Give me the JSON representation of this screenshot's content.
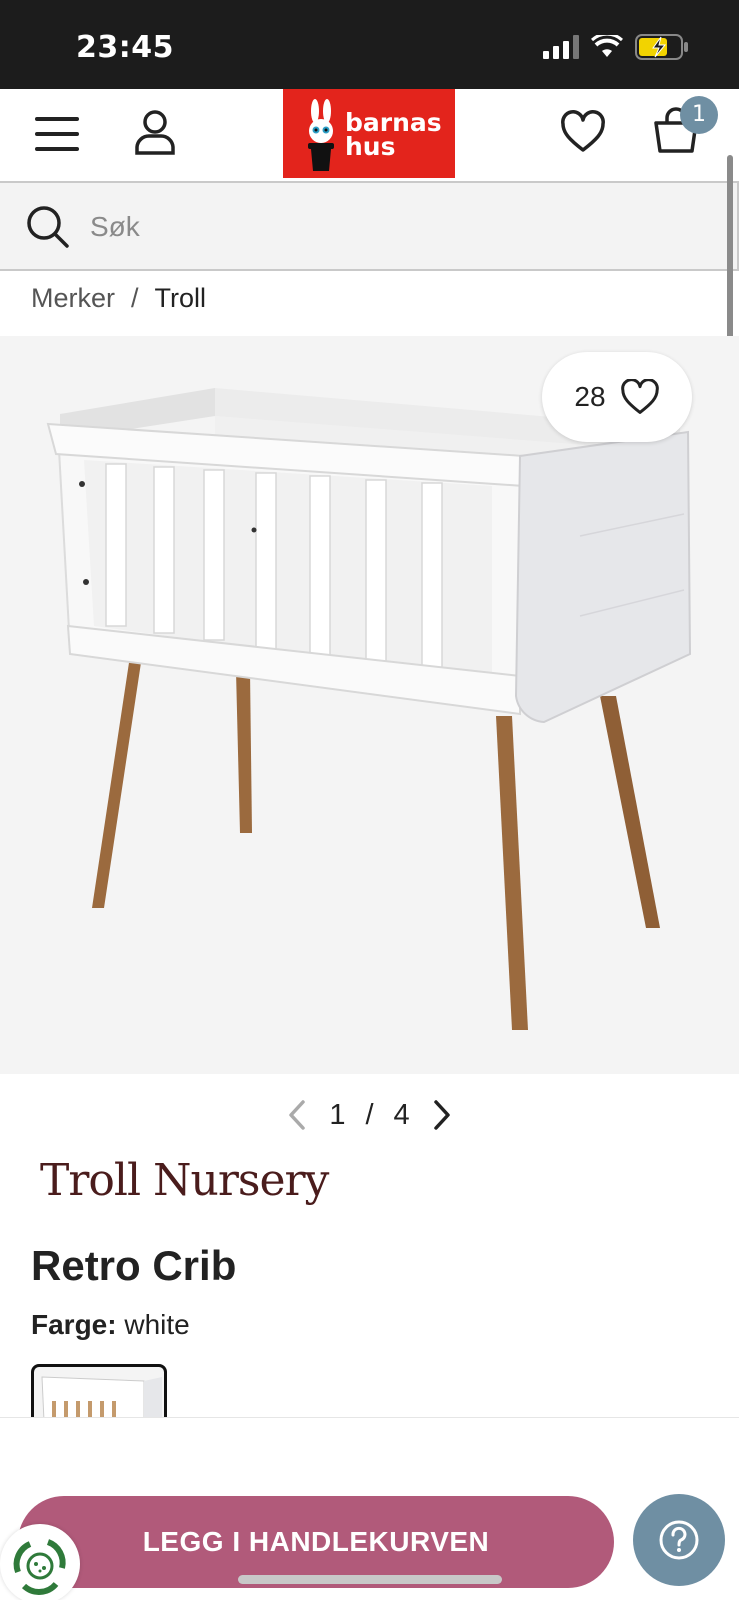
{
  "status_bar": {
    "time": "23:45"
  },
  "header": {
    "logo_line1": "barnas",
    "logo_line2": "hus",
    "cart_count": "1"
  },
  "search": {
    "placeholder": "Søk"
  },
  "breadcrumb": {
    "items": [
      "Merker",
      "Troll"
    ],
    "separator": "/"
  },
  "product": {
    "like_count": "28",
    "pager_current": "1",
    "pager_sep": "/",
    "pager_total": "4",
    "brand": "Troll Nursery",
    "title": "Retro Crib",
    "color_label": "Farge:",
    "color_value": "white"
  },
  "actions": {
    "add_to_cart": "LEGG I HANDLEKURVEN"
  },
  "colors": {
    "brand_red": "#e3241c",
    "cta_pink": "#b15a7a",
    "accent_blue": "#6f8fa3"
  }
}
